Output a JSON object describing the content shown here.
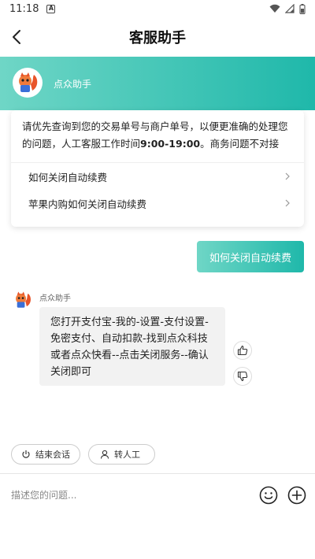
{
  "status_bar": {
    "time": "11:18",
    "badge": "A"
  },
  "header": {
    "title": "客服助手"
  },
  "banner": {
    "name": "点众助手"
  },
  "faq": {
    "notice_pre": "请优先查询到您的交易单号与商户单号，以便更准确的处理您的问题，人工客服工作时间",
    "notice_hours": "9:00-19:00",
    "notice_post": "。商务问题不对接",
    "items": [
      {
        "label": "如何关闭自动续费"
      },
      {
        "label": "苹果内购如何关闭自动续费"
      }
    ]
  },
  "user_message": {
    "text": "如何关闭自动续费"
  },
  "bot_message": {
    "name": "点众助手",
    "text": "您打开支付宝-我的-设置-支付设置-免密支付、自动扣款-找到点众科技或者点众快看--点击关闭服务--确认关闭即可"
  },
  "quick_actions": {
    "end_label": "结束会话",
    "transfer_label": "转人工"
  },
  "input": {
    "placeholder": "描述您的问题..."
  },
  "colors": {
    "accent_start": "#6fd6c6",
    "accent_end": "#1fb8aa",
    "mascot": "#e8542a"
  }
}
